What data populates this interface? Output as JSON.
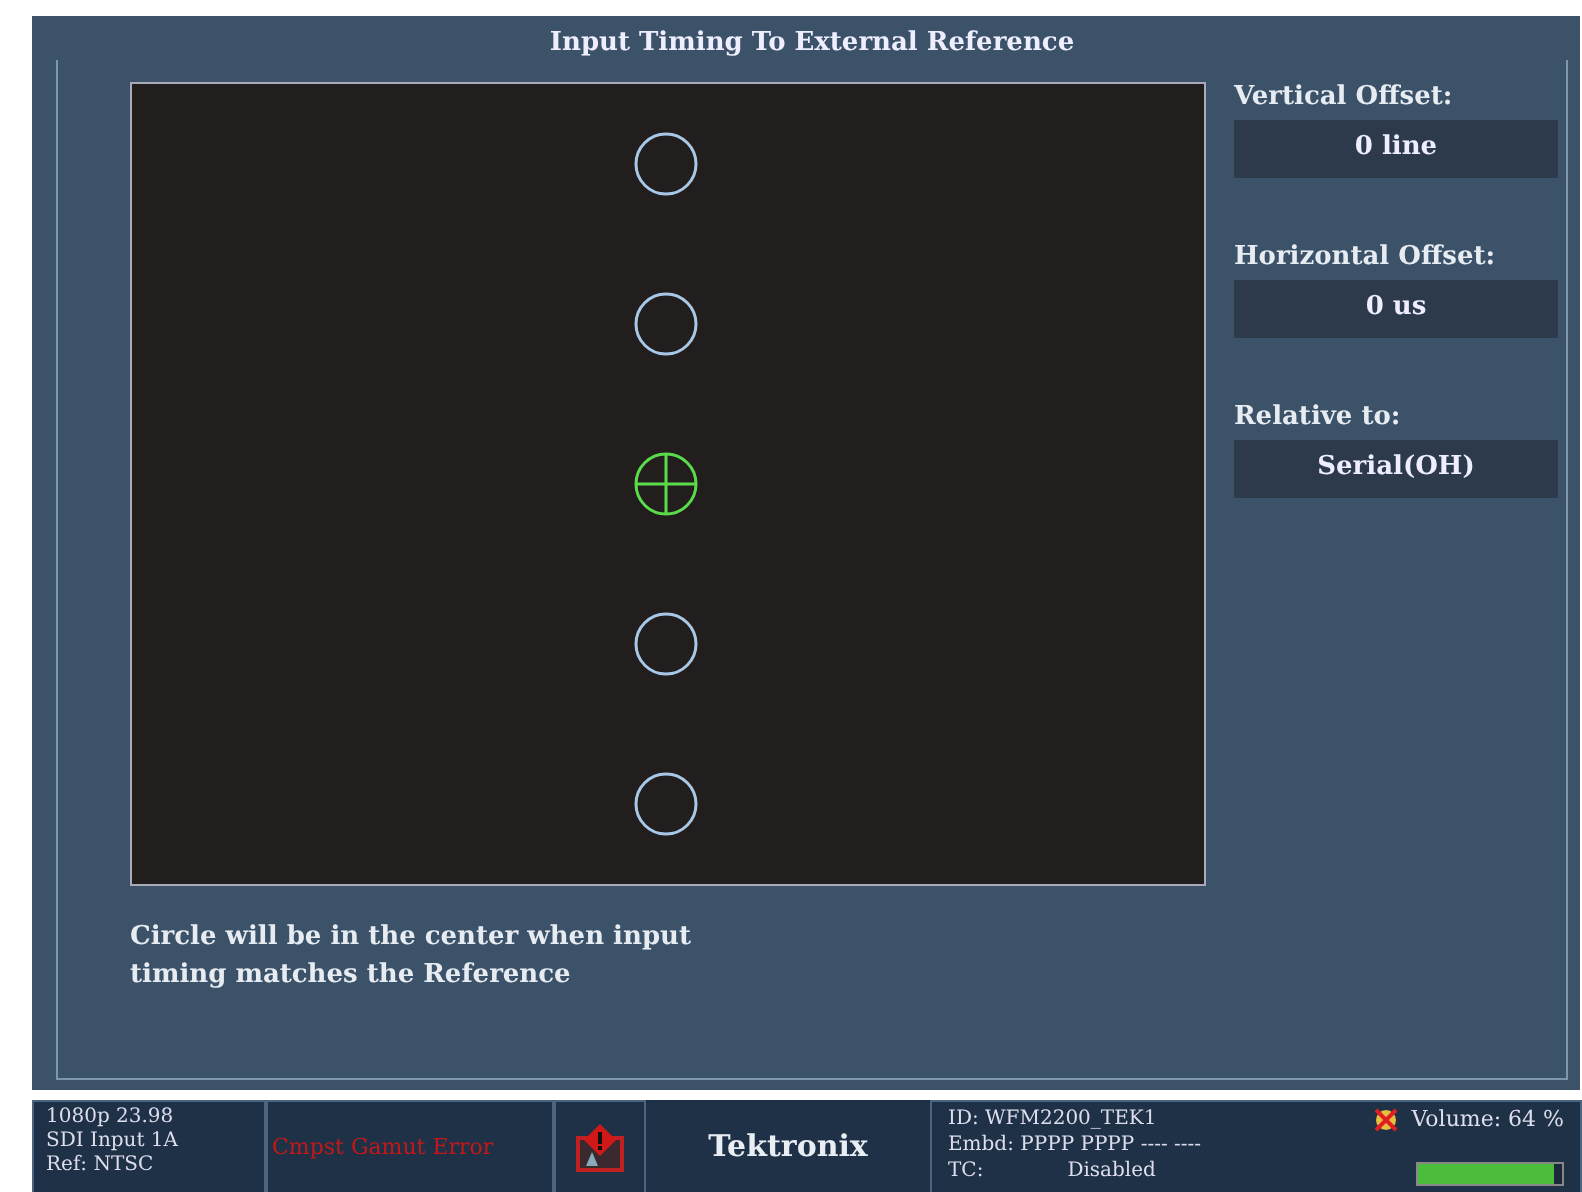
{
  "panel": {
    "title": "Input Timing To External Reference",
    "markers": [
      {
        "kind": "ring"
      },
      {
        "kind": "ring"
      },
      {
        "kind": "crosshair"
      },
      {
        "kind": "ring"
      },
      {
        "kind": "ring"
      }
    ],
    "fields": [
      {
        "label": "Vertical Offset:",
        "value": "0 line"
      },
      {
        "label": "Horizontal Offset:",
        "value": "0 us"
      },
      {
        "label": "Relative to:",
        "value": "Serial(OH)"
      }
    ],
    "note": "Circle will be in the center when input timing matches the Reference"
  },
  "status_bar": {
    "signal": [
      "1080p 23.98",
      "SDI Input 1A",
      "Ref: NTSC"
    ],
    "error": "Cmpst Gamut Error",
    "brand": "Tektronix",
    "id": "ID: WFM2200_TEK1",
    "embd": "Embd: PPPP PPPP ---- ----",
    "tc_label": "TC:",
    "tc_value": "Disabled",
    "volume": "Volume:  64 %",
    "volume_meter": {
      "level": 0.94
    }
  }
}
